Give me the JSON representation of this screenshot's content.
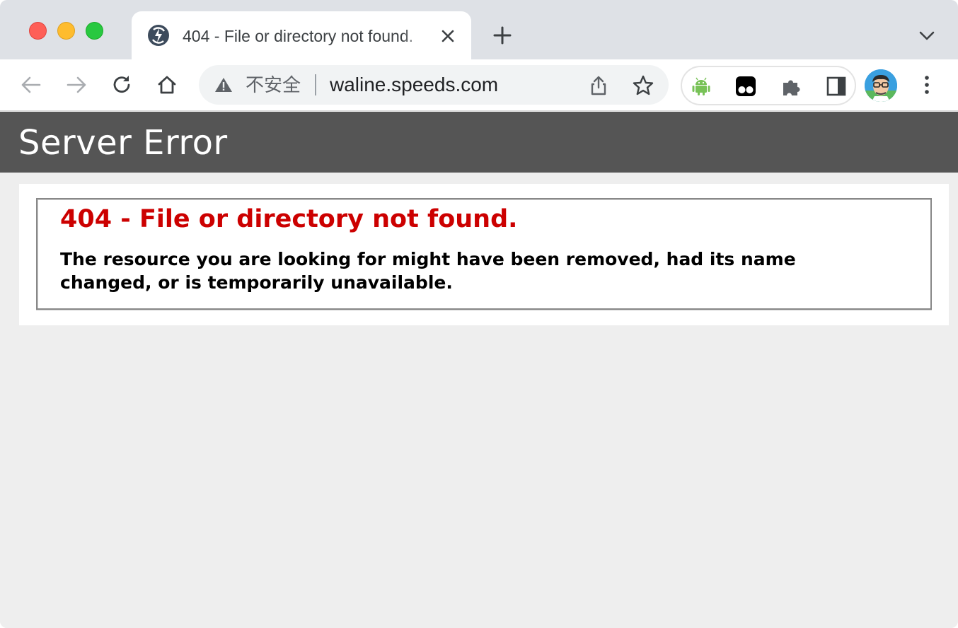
{
  "browser": {
    "tab": {
      "title": "404 - File or directory not found.",
      "favicon": "speeds-favicon-icon"
    },
    "address_bar": {
      "security_label": "不安全",
      "url": "waline.speeds.com"
    },
    "extensions": [
      "android-icon",
      "tampermonkey-icon",
      "puzzle-icon",
      "side-panel-icon"
    ],
    "colors": {
      "tabstrip": "#dee1e6",
      "close": "#fe5f57",
      "minimize": "#febc2e",
      "maximize": "#28c840"
    }
  },
  "page": {
    "header": {
      "title": "Server Error"
    },
    "error": {
      "title": "404 - File or directory not found.",
      "description": "The resource you are looking for might have been removed, had its name changed, or is temporarily unavailable."
    },
    "colors": {
      "header_bg": "#555555",
      "error_title": "#cc0000",
      "page_bg": "#eeeeee"
    }
  }
}
